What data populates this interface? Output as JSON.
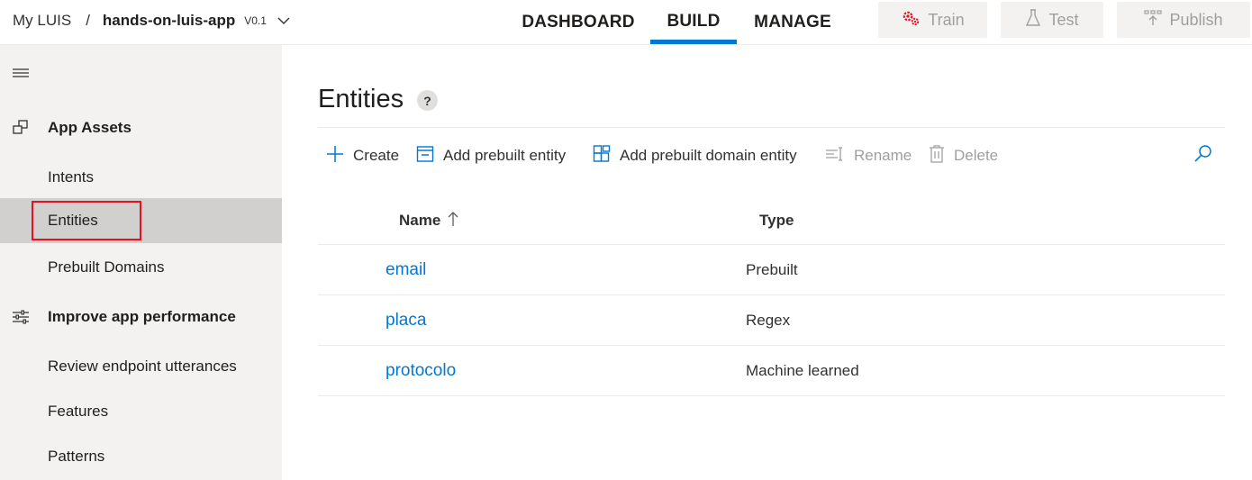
{
  "header": {
    "root_label": "My LUIS",
    "separator": "/",
    "app_name": "hands-on-luis-app",
    "version": "V0.1",
    "tabs": [
      {
        "label": "DASHBOARD",
        "active": false
      },
      {
        "label": "BUILD",
        "active": true
      },
      {
        "label": "MANAGE",
        "active": false
      }
    ],
    "actions": {
      "train": "Train",
      "test": "Test",
      "publish": "Publish"
    }
  },
  "sidebar": {
    "sections": [
      {
        "label": "App Assets",
        "icon": "app-assets-icon",
        "items": [
          "Intents",
          "Entities",
          "Prebuilt Domains"
        ]
      },
      {
        "label": "Improve app performance",
        "icon": "sliders-icon",
        "items": [
          "Review endpoint utterances",
          "Features",
          "Patterns"
        ]
      }
    ],
    "selected": "Entities"
  },
  "main": {
    "title": "Entities",
    "help": "?",
    "toolbar": {
      "create": "Create",
      "add_prebuilt": "Add prebuilt entity",
      "add_domain": "Add prebuilt domain entity",
      "rename": "Rename",
      "delete": "Delete"
    },
    "columns": {
      "name": "Name",
      "type": "Type"
    },
    "rows": [
      {
        "name": "email",
        "type": "Prebuilt"
      },
      {
        "name": "placa",
        "type": "Regex"
      },
      {
        "name": "protocolo",
        "type": "Machine learned"
      }
    ]
  },
  "colors": {
    "accent": "#0078d4",
    "highlight": "#e81123",
    "train_icon": "#e81123",
    "sidebar_bg": "#f3f2f1",
    "sidebar_selected": "#d2d0ce"
  }
}
